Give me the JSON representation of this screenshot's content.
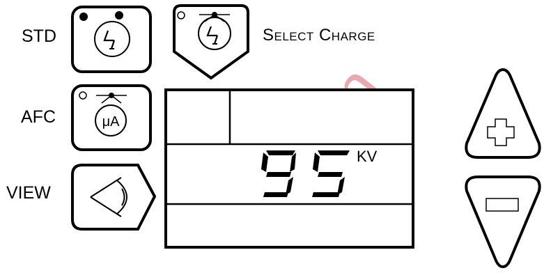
{
  "panel": {
    "std_label": "STD",
    "afc_label": "AFC",
    "view_label": "VIEW",
    "select_charge_label": "Select Charge",
    "ua_glyph": "μA"
  },
  "display": {
    "value": "95",
    "unit": "KV"
  },
  "watermark": {
    "text": "eration",
    "color": "#e8a9b2"
  },
  "icons": {
    "std": "charge-bolt-icon",
    "select_charge": "charge-bolt-icon",
    "afc": "microamp-icon",
    "view": "eye-icon",
    "increase": "plus-icon",
    "decrease": "minus-icon"
  }
}
